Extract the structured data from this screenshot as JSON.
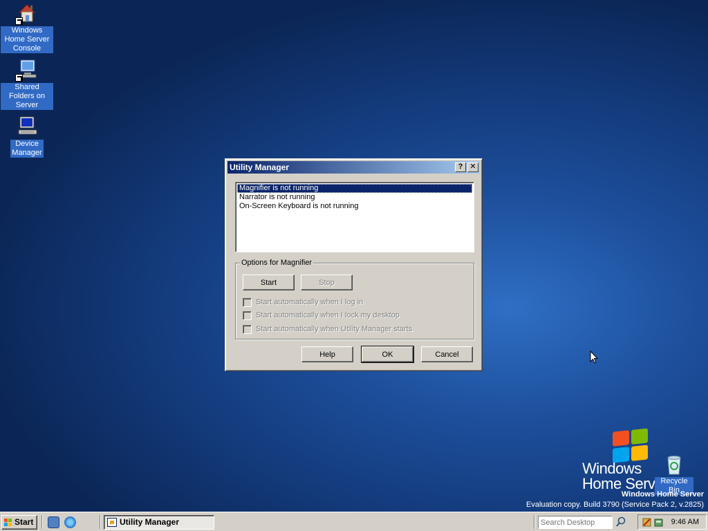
{
  "desktop": {
    "icons": [
      {
        "label": "Windows Home Server Console"
      },
      {
        "label": "Shared Folders on Server"
      },
      {
        "label": "Device Manager"
      },
      {
        "label": "Recycle Bin"
      }
    ],
    "branding": {
      "logo_line1": "Windows",
      "logo_line2": "Home Serv",
      "product": "Windows Home Server",
      "build": "Evaluation copy. Build 3790 (Service Pack 2, v.2825)"
    }
  },
  "dialog": {
    "title": "Utility Manager",
    "help_glyph": "?",
    "close_glyph": "✕",
    "list_items": [
      "Magnifier is not running",
      "Narrator is not running",
      "On-Screen Keyboard is not running"
    ],
    "group_label": "Options for Magnifier",
    "start_button": "Start",
    "stop_button": "Stop",
    "checkboxes": [
      {
        "label": "Start automatically when I log in",
        "checked": false
      },
      {
        "label": "Start automatically when I lock my desktop",
        "checked": false
      },
      {
        "label": "Start automatically when Utility Manager starts",
        "checked": false
      }
    ],
    "help_button": "Help",
    "ok_button": "OK",
    "cancel_button": "Cancel"
  },
  "taskbar": {
    "start_label": "Start",
    "task_label": "Utility Manager",
    "search_placeholder": "Search Desktop",
    "clock": "9:46 AM"
  },
  "colors": {
    "title_start": "#0a246a",
    "title_end": "#a6caf0",
    "selection": "#0a246a",
    "face": "#d4d0c8"
  }
}
